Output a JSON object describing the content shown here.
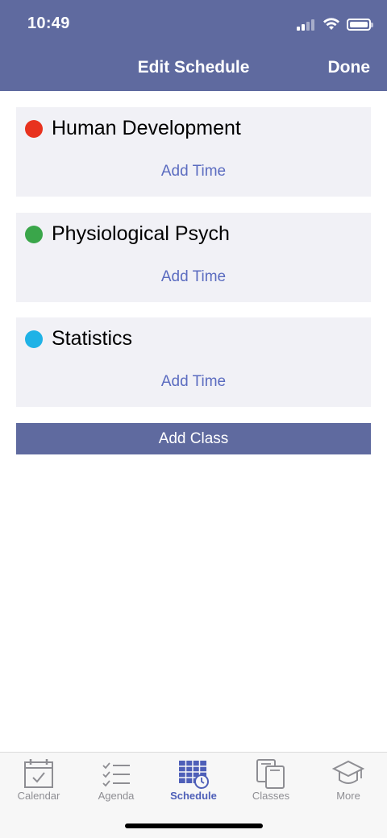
{
  "status_bar": {
    "time": "10:49"
  },
  "nav": {
    "title": "Edit Schedule",
    "done_label": "Done"
  },
  "classes": [
    {
      "name": "Human Development",
      "color": "#e8321e",
      "add_time_label": "Add Time"
    },
    {
      "name": "Physiological Psych",
      "color": "#3aa64a",
      "add_time_label": "Add Time"
    },
    {
      "name": "Statistics",
      "color": "#1fb2e6",
      "add_time_label": "Add Time"
    }
  ],
  "add_class_label": "Add Class",
  "tabs": [
    {
      "label": "Calendar",
      "icon": "calendar-icon",
      "active": false
    },
    {
      "label": "Agenda",
      "icon": "agenda-icon",
      "active": false
    },
    {
      "label": "Schedule",
      "icon": "schedule-icon",
      "active": true
    },
    {
      "label": "Classes",
      "icon": "classes-icon",
      "active": false
    },
    {
      "label": "More",
      "icon": "graduation-cap-icon",
      "active": false
    }
  ],
  "colors": {
    "header": "#5f6a9f",
    "accent": "#5b6cc0",
    "active_tab": "#4e5fb8"
  }
}
